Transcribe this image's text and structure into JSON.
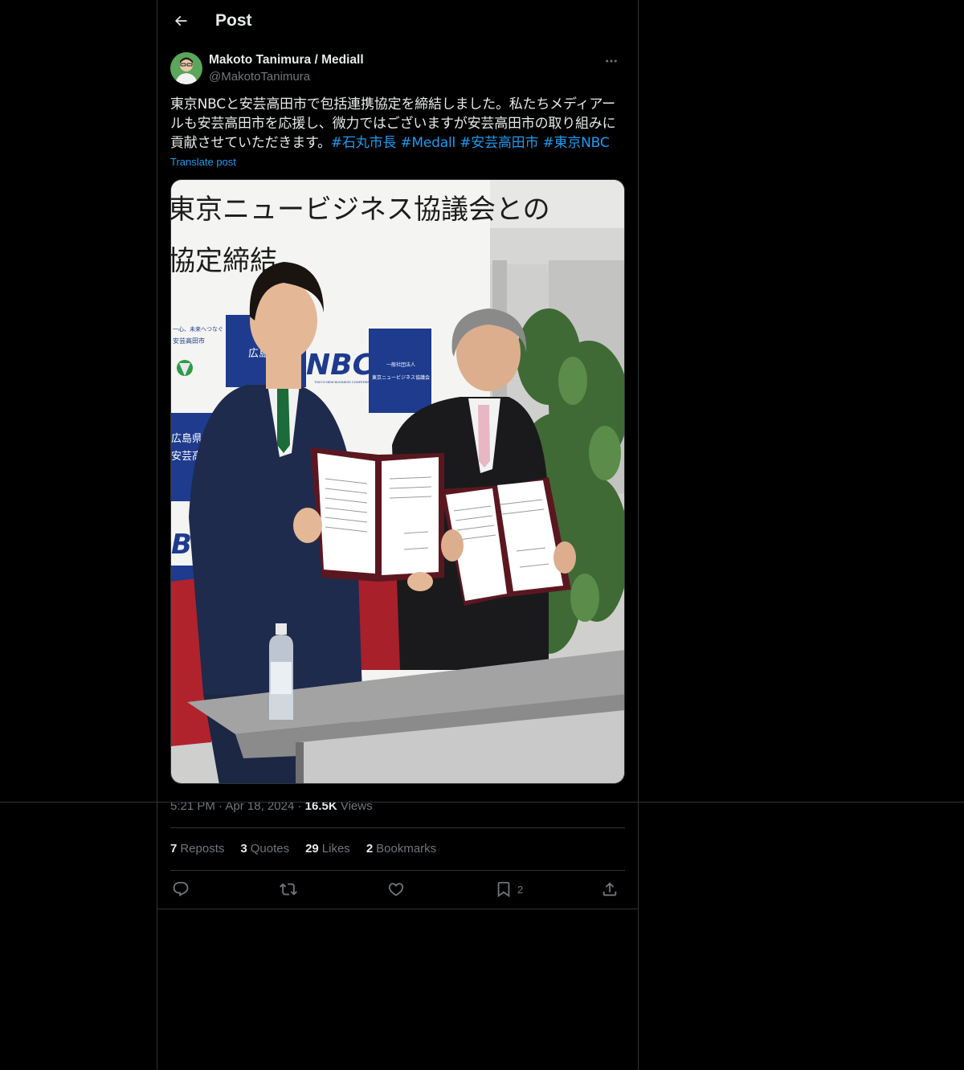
{
  "header": {
    "title": "Post"
  },
  "author": {
    "name": "Makoto Tanimura / Mediall",
    "handle": "@MakotoTanimura"
  },
  "post": {
    "text": "東京NBCと安芸高田市で包括連携協定を締結しました。私たちメディアールも安芸高田市を応援し、微力ではございますが安芸高田市の取り組みに貢献させていただきます。",
    "hashtags": [
      "#石丸市長",
      "#Medall",
      "#安芸高田市",
      "#東京NBC"
    ],
    "translate_label": "Translate post"
  },
  "media": {
    "banner_line1": "東京ニュービジネス協議会との",
    "banner_line2": "協定締結",
    "panel_left_line1": "一心、未来へつなぐ",
    "panel_left_line2": "安芸高田市",
    "panel_left_line3": "広島県",
    "panel_left_line4": "安芸高田",
    "panel_mid": "広島\n安芸",
    "panel_nbc": "NBC",
    "panel_nbc_sub": "TOKYO NEW BUSINESS CONFERENCE",
    "panel_right_line1": "一般社団法人",
    "panel_right_line2": "東京ニュービジネス協議会"
  },
  "meta": {
    "time": "5:21 PM",
    "date": "Apr 18, 2024",
    "views_count": "16.5K",
    "views_label": "Views"
  },
  "stats": {
    "reposts_count": "7",
    "reposts_label": "Reposts",
    "quotes_count": "3",
    "quotes_label": "Quotes",
    "likes_count": "29",
    "likes_label": "Likes",
    "bookmarks_count": "2",
    "bookmarks_label": "Bookmarks"
  },
  "actions": {
    "bookmark_count": "2"
  },
  "colors": {
    "background": "#000000",
    "text": "#e7e9ea",
    "muted": "#71767b",
    "link": "#1d9bf0",
    "border": "#2f3336"
  },
  "icons": [
    "back-arrow-icon",
    "more-icon",
    "reply-icon",
    "repost-icon",
    "like-icon",
    "bookmark-icon",
    "share-icon"
  ]
}
